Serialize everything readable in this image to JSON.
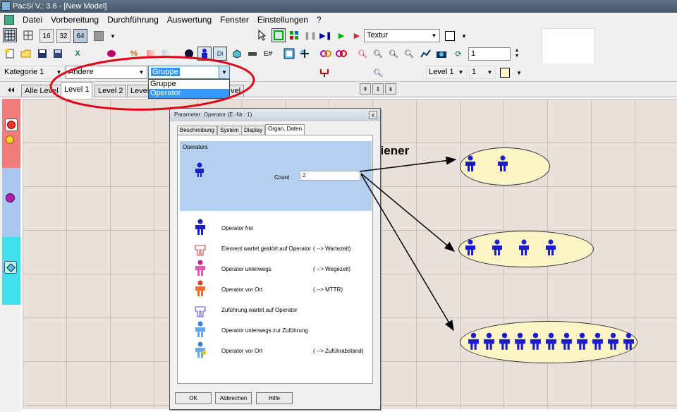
{
  "window": {
    "title": "PacSi V.: 3.6 - [New Model]"
  },
  "menu": [
    "Datei",
    "Vorbereitung",
    "Durchführung",
    "Auswertung",
    "Fenster",
    "Einstellungen",
    "?"
  ],
  "toolbar1": {
    "zoom_buttons": [
      "16",
      "32",
      "64"
    ],
    "texture_combo": "Textur"
  },
  "toolbar2": {
    "text_button": "E#",
    "spin_value": "1"
  },
  "toolbar3": {
    "category_combo": "Kategorie 1",
    "type_combo": "Andere",
    "group_combo": "Gruppe",
    "dropdown_options": [
      "Gruppe",
      "Operator"
    ],
    "level_combo": "Level 1",
    "level_num_combo": "1"
  },
  "level_tabs": [
    "Alle Level",
    "Level 1",
    "Level 2",
    "Level",
    "vel"
  ],
  "dialog": {
    "title": "Parameter: Operator (E.-Nr.: 1)",
    "close": "x",
    "tabs": [
      "Beschreibung",
      "System",
      "Display",
      "Organ. Daten"
    ],
    "group_label": "Operators",
    "count_label": "Count",
    "count_value": "2",
    "legend": [
      {
        "label": "Operator  frei",
        "note": ""
      },
      {
        "label": "Element wartet gestört auf Operator",
        "note": "( --> Wartezeit)"
      },
      {
        "label": "Operator unterwegs",
        "note": "( --> Wegezeit)"
      },
      {
        "label": "Operator  vor Ort",
        "note": "( --> MTTR)"
      },
      {
        "label": "Zuführung wartet auf Operator",
        "note": ""
      },
      {
        "label": "Operator unterwegs zur Zuführung",
        "note": ""
      },
      {
        "label": "Operator  vor Ort",
        "note": "( --> Zuführabstand)"
      }
    ],
    "buttons": {
      "ok": "OK",
      "cancel": "Abbrechen",
      "help": "Hilfe"
    }
  },
  "annotation": {
    "text": "Anzahl Bediener"
  },
  "colors": {
    "operator": "#1c1cc8",
    "highlight": "#3399ff",
    "panel_blue": "#b3d1ef",
    "ellipse_fill": "#fbf4c5",
    "red_mark": "#e0001a"
  },
  "examples": {
    "counts": [
      2,
      4,
      11
    ]
  }
}
